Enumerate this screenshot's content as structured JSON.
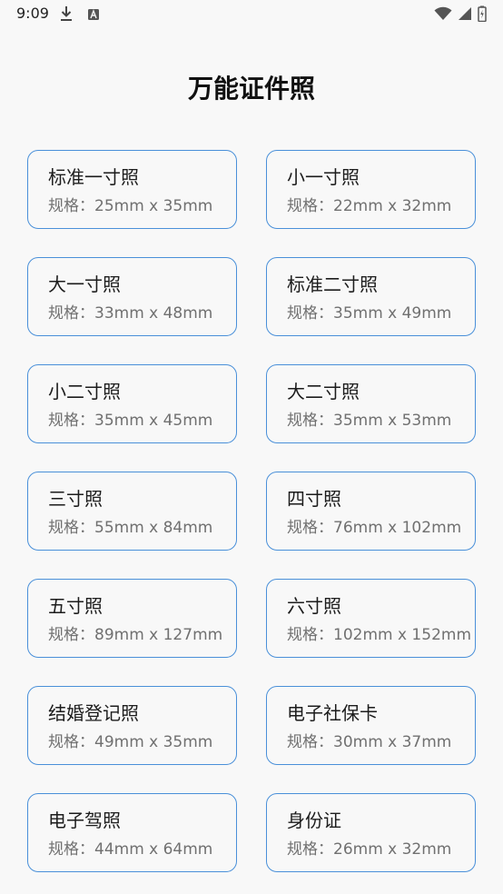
{
  "status_bar": {
    "time": "9:09"
  },
  "title": "万能证件照",
  "spec_prefix": "规格：",
  "cards": [
    {
      "name": "标准一寸照",
      "spec": "规格：25mm x 35mm"
    },
    {
      "name": "小一寸照",
      "spec": "规格：22mm x 32mm"
    },
    {
      "name": "大一寸照",
      "spec": "规格：33mm x 48mm"
    },
    {
      "name": "标准二寸照",
      "spec": "规格：35mm x 49mm"
    },
    {
      "name": "小二寸照",
      "spec": "规格：35mm x 45mm"
    },
    {
      "name": "大二寸照",
      "spec": "规格：35mm x 53mm"
    },
    {
      "name": "三寸照",
      "spec": "规格：55mm x 84mm"
    },
    {
      "name": "四寸照",
      "spec": "规格：76mm x 102mm"
    },
    {
      "name": "五寸照",
      "spec": "规格：89mm x 127mm"
    },
    {
      "name": "六寸照",
      "spec": "规格：102mm x 152mm"
    },
    {
      "name": "结婚登记照",
      "spec": "规格：49mm x 35mm"
    },
    {
      "name": "电子社保卡",
      "spec": "规格：30mm x 37mm"
    },
    {
      "name": "电子驾照",
      "spec": "规格：44mm x 64mm"
    },
    {
      "name": "身份证",
      "spec": "规格：26mm x 32mm"
    }
  ],
  "colors": {
    "card_border": "#4a90d9",
    "background": "#f8f8f8",
    "spec_text": "#707070"
  },
  "icons": {
    "download": "download-icon",
    "notification": "text-notification-icon",
    "wifi": "wifi-icon",
    "signal": "cell-signal-icon",
    "battery": "battery-icon"
  }
}
